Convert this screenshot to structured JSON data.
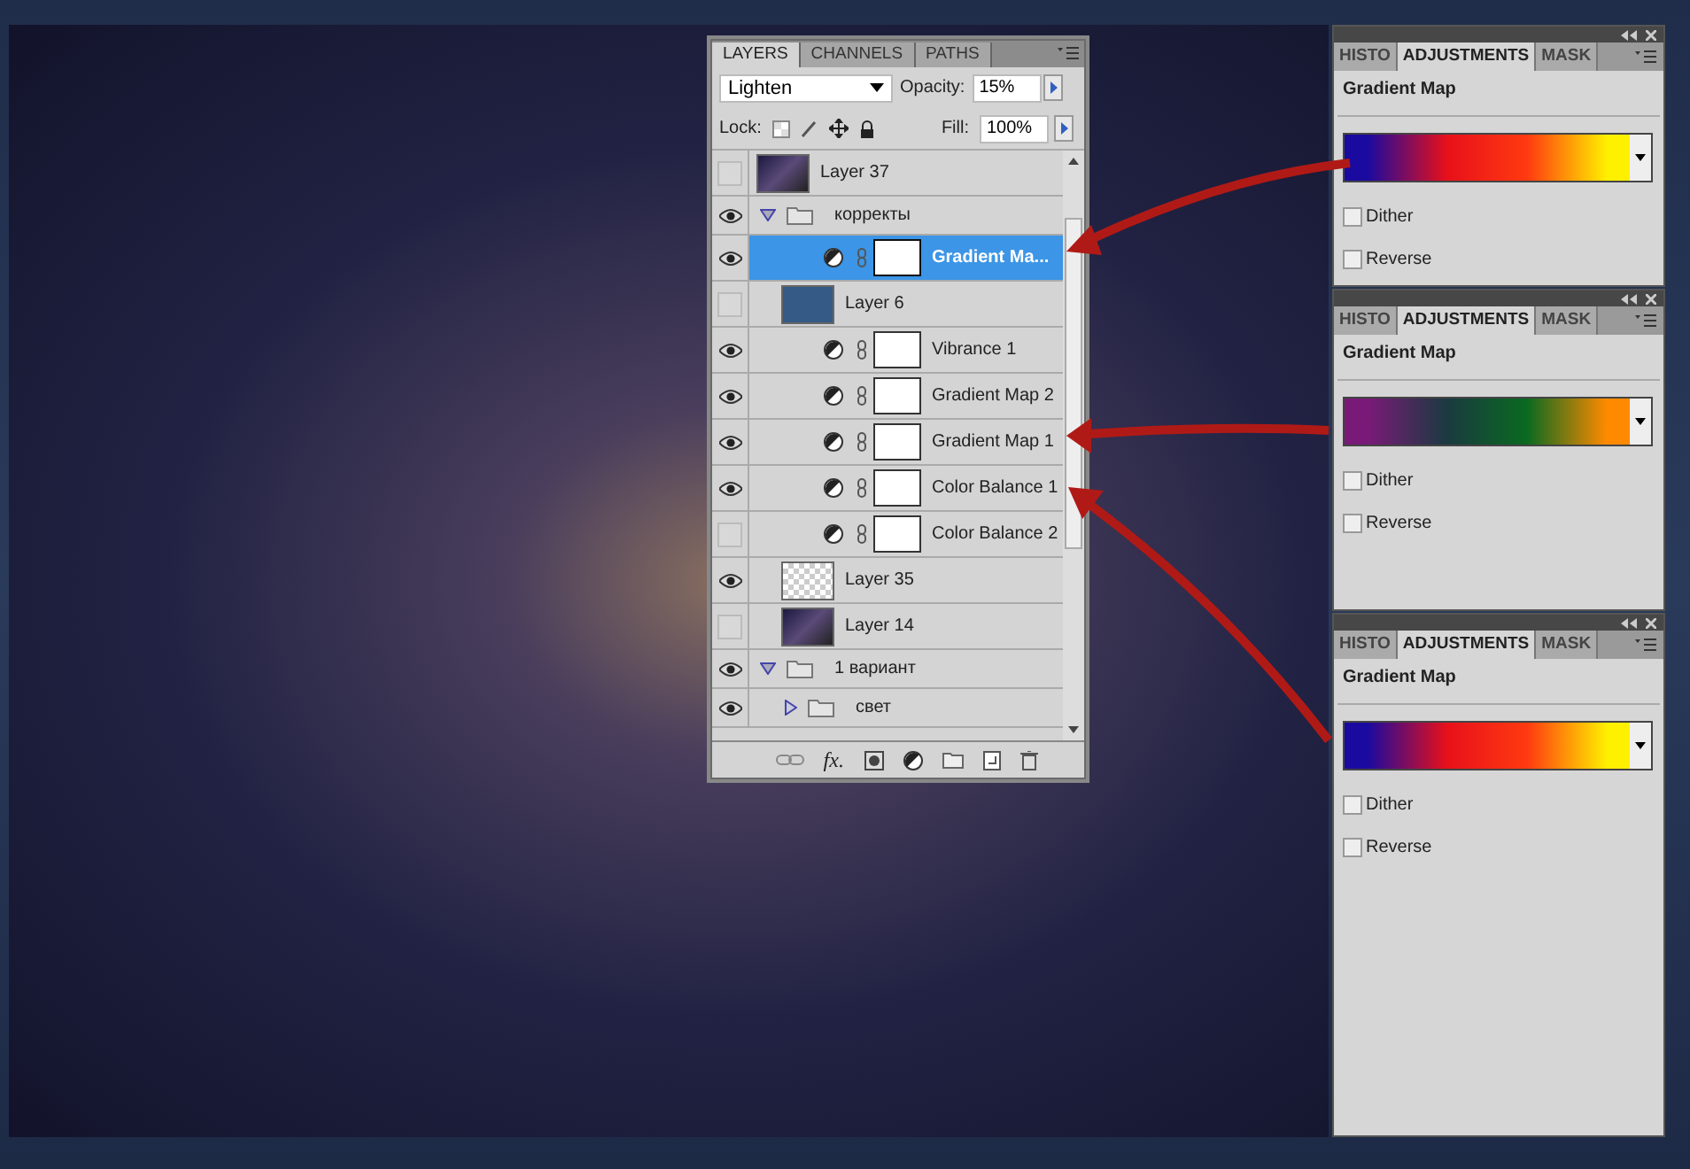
{
  "layers_panel": {
    "tabs": [
      {
        "label": "LAYERS",
        "selected": true
      },
      {
        "label": "CHANNELS",
        "selected": false
      },
      {
        "label": "PATHS",
        "selected": false
      }
    ],
    "blend_mode": "Lighten",
    "opacity_label": "Opacity:",
    "opacity": "15%",
    "lock_label": "Lock:",
    "fill_label": "Fill:",
    "fill": "100%",
    "layers": [
      {
        "kind": "image",
        "name": "Layer 37",
        "visible": false,
        "selected": false
      },
      {
        "kind": "group",
        "name": "корректы",
        "visible": true,
        "selected": false,
        "expanded": true,
        "children": [
          {
            "kind": "adjustment",
            "name": "Gradient Ma...",
            "visible": true,
            "selected": true
          },
          {
            "kind": "fill",
            "name": "Layer 6",
            "visible": false,
            "selected": false
          },
          {
            "kind": "adjustment",
            "name": "Vibrance 1",
            "visible": true,
            "selected": false
          },
          {
            "kind": "adjustment",
            "name": "Gradient Map 2",
            "visible": true,
            "selected": false
          },
          {
            "kind": "adjustment",
            "name": "Gradient Map 1",
            "visible": true,
            "selected": false
          },
          {
            "kind": "adjustment",
            "name": "Color Balance 1",
            "visible": true,
            "selected": false
          },
          {
            "kind": "adjustment",
            "name": "Color Balance 2",
            "visible": false,
            "selected": false
          },
          {
            "kind": "transparent",
            "name": "Layer 35",
            "visible": true,
            "selected": false
          },
          {
            "kind": "image",
            "name": "Layer 14",
            "visible": false,
            "selected": false
          }
        ]
      },
      {
        "kind": "group",
        "name": "1 вариант",
        "visible": true,
        "selected": false,
        "expanded": true,
        "children": [
          {
            "kind": "group",
            "name": "свет",
            "visible": true,
            "selected": false,
            "expanded": false
          }
        ]
      }
    ],
    "fx_label": "fx."
  },
  "adjustment_panels": [
    {
      "tabs": [
        {
          "label": "HISTO",
          "selected": false
        },
        {
          "label": "ADJUSTMENTS",
          "selected": true
        },
        {
          "label": "MASK",
          "selected": false
        }
      ],
      "title": "Gradient Map",
      "gradient_stops": [
        {
          "color": "#1a0aa0"
        },
        {
          "color": "#e8101a"
        },
        {
          "color": "#ff3a10"
        },
        {
          "color": "#fff000"
        }
      ],
      "options": [
        {
          "label": "Dither",
          "checked": false
        },
        {
          "label": "Reverse",
          "checked": false
        }
      ]
    },
    {
      "tabs": [
        {
          "label": "HISTO",
          "selected": false
        },
        {
          "label": "ADJUSTMENTS",
          "selected": true
        },
        {
          "label": "MASK",
          "selected": false
        }
      ],
      "title": "Gradient Map",
      "gradient_stops": [
        {
          "color": "#7a1a78"
        },
        {
          "color": "#1a3a40"
        },
        {
          "color": "#0a6a20"
        },
        {
          "color": "#ff8a00"
        }
      ],
      "options": [
        {
          "label": "Dither",
          "checked": false
        },
        {
          "label": "Reverse",
          "checked": false
        }
      ]
    },
    {
      "tabs": [
        {
          "label": "HISTO",
          "selected": false
        },
        {
          "label": "ADJUSTMENTS",
          "selected": true
        },
        {
          "label": "MASK",
          "selected": false
        }
      ],
      "title": "Gradient Map",
      "gradient_stops": [
        {
          "color": "#1a0aa0"
        },
        {
          "color": "#e8101a"
        },
        {
          "color": "#ff3a10"
        },
        {
          "color": "#fff000"
        }
      ],
      "options": [
        {
          "label": "Dither",
          "checked": false
        },
        {
          "label": "Reverse",
          "checked": false
        }
      ]
    }
  ]
}
